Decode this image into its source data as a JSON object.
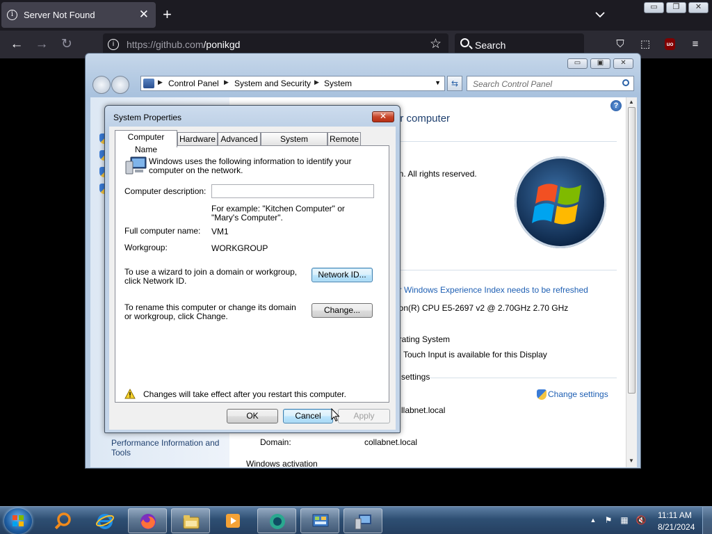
{
  "browser": {
    "tab_title": "Server Not Found",
    "url_host": "https://github.com",
    "url_path": "/ponikgd",
    "search_placeholder": "Search"
  },
  "control_panel": {
    "breadcrumb": [
      "Control Panel",
      "System and Security",
      "System"
    ],
    "search_placeholder": "Search Control Panel",
    "heading_fragment": "ur computer",
    "copyright_fragment": "on.  All rights reserved.",
    "wei_link": "ur Windows Experience Index needs to be refreshed",
    "processor_fragment": "eon(R) CPU E5-2697 v2 @ 2.70GHz   2.70 GHz",
    "os_fragment": "erating System",
    "pen_touch": "Touch Input is available for this Display",
    "settings_fragment": "settings",
    "change_settings": "Change settings",
    "fqdn_fragment": "llabnet.local",
    "domain_label": "Domain:",
    "domain_value": "collabnet.local",
    "activation_fragment": "Windows activation",
    "left_link": "Performance Information and Tools"
  },
  "dialog": {
    "title": "System Properties",
    "tabs": [
      "Computer Name",
      "Hardware",
      "Advanced",
      "System Protection",
      "Remote"
    ],
    "intro": "Windows uses the following information to identify your computer on the network.",
    "description_label": "Computer description:",
    "description_value": "",
    "example": "For example: \"Kitchen Computer\" or \"Mary's Computer\".",
    "full_name_label": "Full computer name:",
    "full_name_value": "VM1",
    "workgroup_label": "Workgroup:",
    "workgroup_value": "WORKGROUP",
    "network_id_text": "To use a wizard to join a domain or workgroup, click Network ID.",
    "network_id_button": "Network ID...",
    "rename_text": "To rename this computer or change its domain or workgroup, click Change.",
    "change_button": "Change...",
    "warning": "Changes will take effect after you restart this computer.",
    "ok": "OK",
    "cancel": "Cancel",
    "apply": "Apply"
  },
  "taskbar": {
    "time": "11:11 AM",
    "date": "8/21/2024"
  }
}
